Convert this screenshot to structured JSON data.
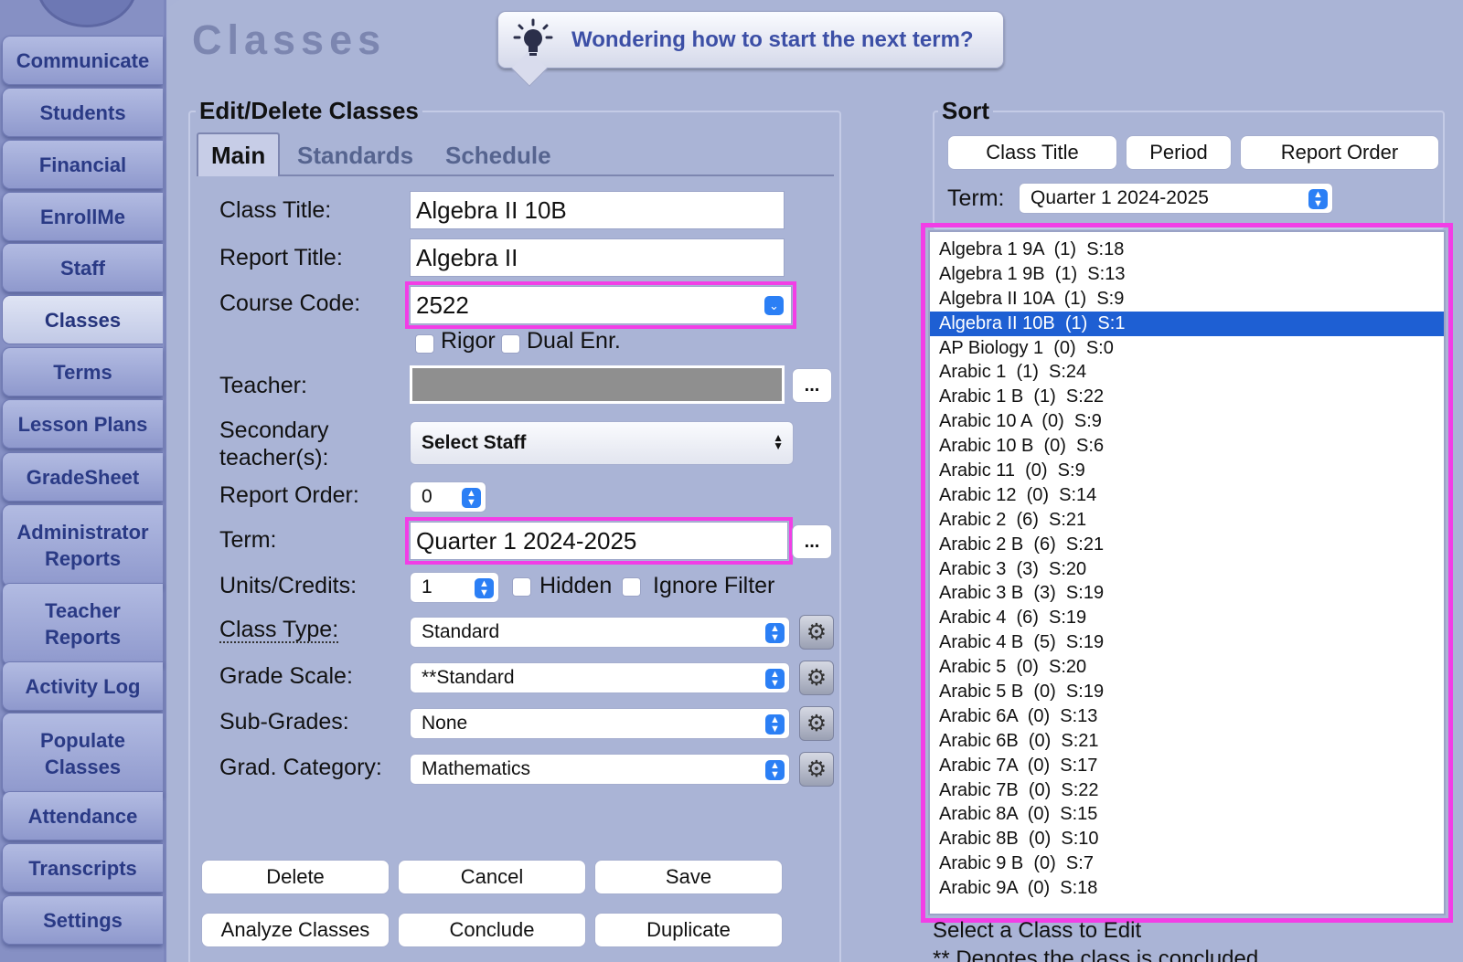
{
  "sidebar": {
    "items": [
      {
        "label": "Communicate"
      },
      {
        "label": "Students"
      },
      {
        "label": "Financial"
      },
      {
        "label": "EnrollMe"
      },
      {
        "label": "Staff"
      },
      {
        "label": "Classes",
        "active": true
      },
      {
        "label": "Terms"
      },
      {
        "label": "Lesson Plans"
      },
      {
        "label": "GradeSheet"
      },
      {
        "label": "Administrator\nReports"
      },
      {
        "label": "Teacher\nReports"
      },
      {
        "label": "Activity Log"
      },
      {
        "label": "Populate\nClasses"
      },
      {
        "label": "Attendance"
      },
      {
        "label": "Transcripts"
      },
      {
        "label": "Settings"
      }
    ]
  },
  "page": {
    "title": "Classes",
    "tip": "Wondering how to start the next term?"
  },
  "edit": {
    "legend": "Edit/Delete Classes",
    "tabs": [
      "Main",
      "Standards",
      "Schedule"
    ],
    "class_title_label": "Class Title:",
    "class_title": "Algebra II 10B",
    "report_title_label": "Report Title:",
    "report_title": "Algebra II",
    "course_code_label": "Course Code:",
    "course_code": "2522",
    "rigor_label": "Rigor",
    "dual_label": "Dual Enr.",
    "teacher_label": "Teacher:",
    "secondary_label": "Secondary teacher(s):",
    "secondary_value": "Select Staff",
    "report_order_label": "Report Order:",
    "report_order": "0",
    "term_label": "Term:",
    "term": "Quarter 1 2024-2025",
    "units_label": "Units/Credits:",
    "units": "1",
    "hidden_label": "Hidden",
    "ignore_label": "Ignore Filter",
    "class_type_label": "Class Type:",
    "class_type": "Standard",
    "grade_scale_label": "Grade Scale:",
    "grade_scale": "**Standard",
    "sub_grades_label": "Sub-Grades:",
    "sub_grades": "None",
    "grad_cat_label": "Grad. Category:",
    "grad_cat": "Mathematics",
    "ellipsis": "...",
    "buttons": {
      "delete": "Delete",
      "cancel": "Cancel",
      "save": "Save",
      "analyze": "Analyze Classes",
      "conclude": "Conclude",
      "duplicate": "Duplicate"
    }
  },
  "sort": {
    "legend": "Sort",
    "buttons": [
      "Class Title",
      "Period",
      "Report Order"
    ],
    "term_label": "Term:",
    "term": "Quarter 1 2024-2025"
  },
  "classes": [
    "Algebra 1 9A  (1)  S:18",
    "Algebra 1 9B  (1)  S:13",
    "Algebra II 10A  (1)  S:9",
    "Algebra II 10B  (1)  S:1",
    "AP Biology 1  (0)  S:0",
    "Arabic 1  (1)  S:24",
    "Arabic 1 B  (1)  S:22",
    "Arabic 10 A  (0)  S:9",
    "Arabic 10 B  (0)  S:6",
    "Arabic 11  (0)  S:9",
    "Arabic 12  (0)  S:14",
    "Arabic 2  (6)  S:21",
    "Arabic 2 B  (6)  S:21",
    "Arabic 3  (3)  S:20",
    "Arabic 3 B  (3)  S:19",
    "Arabic 4  (6)  S:19",
    "Arabic 4 B  (5)  S:19",
    "Arabic 5  (0)  S:20",
    "Arabic 5 B  (0)  S:19",
    "Arabic 6A  (0)  S:13",
    "Arabic 6B  (0)  S:21",
    "Arabic 7A  (0)  S:17",
    "Arabic 7B  (0)  S:22",
    "Arabic 8A  (0)  S:15",
    "Arabic 8B  (0)  S:10",
    "Arabic 9 B  (0)  S:7",
    "Arabic 9A  (0)  S:18"
  ],
  "selected_class": "Algebra II 10B  (1)  S:1",
  "footer": {
    "line1": "Select a Class to Edit",
    "line2": "** Denotes the class is concluded"
  },
  "colors": {
    "highlight": "#f23ee6",
    "selection": "#1e5fd3",
    "accent": "#2b7ff5"
  }
}
